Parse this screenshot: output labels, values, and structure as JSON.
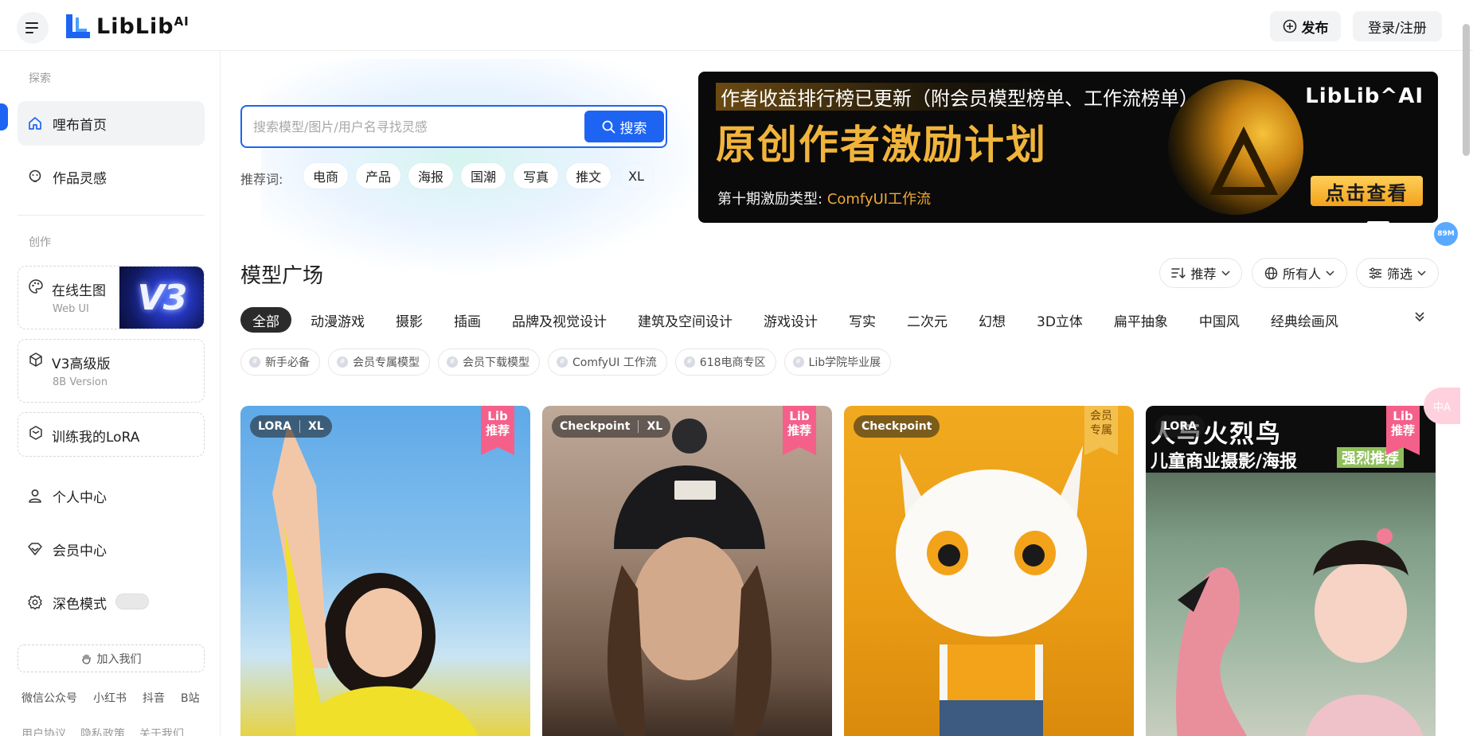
{
  "header": {
    "logo_text": "LibLib",
    "logo_sup": "AI",
    "publish_label": "发布",
    "login_label": "登录/注册"
  },
  "sidebar": {
    "explore_label": "探索",
    "create_label": "创作",
    "nav": [
      {
        "label": "哩布首页",
        "icon": "home-icon"
      },
      {
        "label": "作品灵感",
        "icon": "inspiration-icon"
      }
    ],
    "create_cards": [
      {
        "title": "在线生图",
        "subtitle": "Web UI",
        "badge": "V3"
      },
      {
        "title": "V3高级版",
        "subtitle": "8B Version"
      },
      {
        "title": "训练我的LoRA"
      }
    ],
    "account": [
      {
        "label": "个人中心",
        "icon": "user-icon"
      },
      {
        "label": "会员中心",
        "icon": "diamond-icon"
      },
      {
        "label": "深色模式",
        "icon": "gear-icon"
      }
    ],
    "join_label": "加入我们",
    "social": [
      "微信公众号",
      "小红书",
      "抖音",
      "B站"
    ],
    "legal": [
      "用户协议",
      "隐私政策",
      "关于我们"
    ]
  },
  "search": {
    "placeholder": "搜索模型/图片/用户名寻找灵感",
    "button_label": "搜索",
    "rec_label": "推荐词:",
    "rec_tags": [
      "电商",
      "产品",
      "海报",
      "国潮",
      "写真",
      "推文",
      "XL"
    ]
  },
  "banner": {
    "line1": "作者收益排行榜已更新（附会员模型榜单、工作流榜单）",
    "title": "原创作者激励计划",
    "sub_prefix": "第十期激励类型:",
    "sub_highlight": "ComfyUI工作流",
    "logo": "LibLib^AI",
    "cta": "点击查看"
  },
  "badges": {
    "memory": "89M",
    "translate": "中A"
  },
  "models": {
    "section_title": "模型广场",
    "sort_label": "推荐",
    "owner_label": "所有人",
    "filter_label": "筛选",
    "categories": [
      "全部",
      "动漫游戏",
      "摄影",
      "插画",
      "品牌及视觉设计",
      "建筑及空间设计",
      "游戏设计",
      "写实",
      "二次元",
      "幻想",
      "3D立体",
      "扁平抽象",
      "中国风",
      "经典绘画风"
    ],
    "chips": [
      "新手必备",
      "会员专属模型",
      "会员下载模型",
      "ComfyUI 工作流",
      "618电商专区",
      "Lib学院毕业展"
    ],
    "cards": [
      {
        "tags": [
          "LORA",
          "XL"
        ],
        "ribbon": [
          "Lib",
          "推荐"
        ],
        "ribbon_style": "pink"
      },
      {
        "tags": [
          "Checkpoint",
          "XL"
        ],
        "ribbon": [
          "Lib",
          "推荐"
        ],
        "ribbon_style": "pink"
      },
      {
        "tags": [
          "Checkpoint"
        ],
        "ribbon": [
          "会员",
          "专属"
        ],
        "ribbon_style": "gold"
      },
      {
        "tags": [
          "LORA"
        ],
        "ribbon": [
          "Lib",
          "推荐"
        ],
        "ribbon_style": "pink",
        "overlay_title": "人与火烈鸟",
        "overlay_sub": "儿童商业摄影/海报",
        "overlay_side": "强烈推荐"
      }
    ]
  },
  "colors": {
    "accent": "#1d64f2",
    "ribbon_pink": "#f5608b",
    "ribbon_gold": "#f3c04e",
    "banner_gold": "#f1b43b"
  }
}
